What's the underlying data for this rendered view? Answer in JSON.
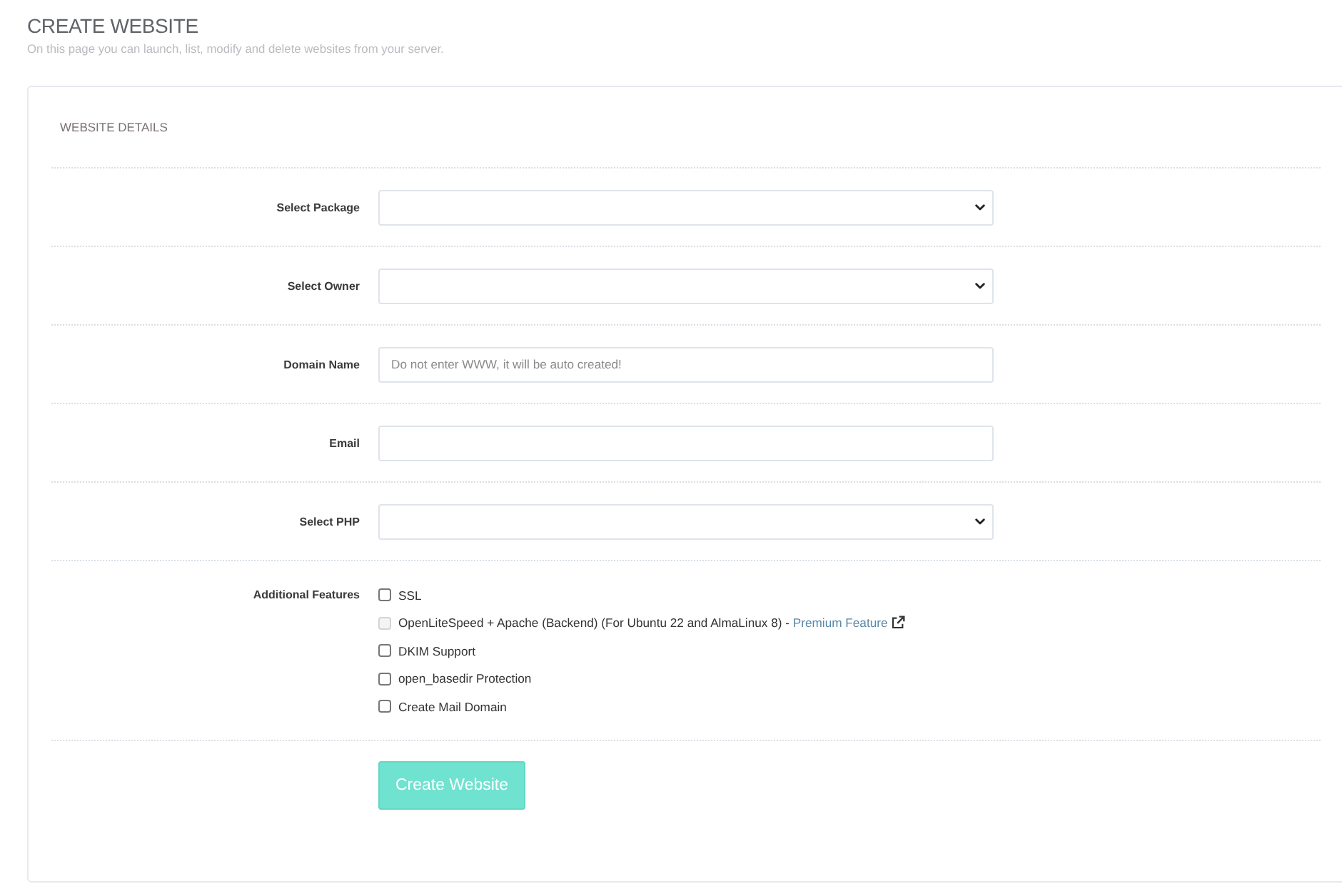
{
  "page": {
    "title": "CREATE WEBSITE",
    "subtitle": "On this page you can launch, list, modify and delete websites from your server."
  },
  "card": {
    "heading": "WEBSITE DETAILS",
    "fields": [
      {
        "label": "Select Package",
        "kind": "select"
      },
      {
        "label": "Select Owner",
        "kind": "select"
      },
      {
        "label": "Domain Name",
        "kind": "text",
        "placeholder": "Do not enter WWW, it will be auto created!"
      },
      {
        "label": "Email",
        "kind": "text"
      },
      {
        "label": "Select PHP",
        "kind": "select"
      }
    ],
    "features": {
      "label": "Additional Features",
      "options": [
        {
          "label": "SSL",
          "checked": false,
          "disabled": false
        },
        {
          "label": "OpenLiteSpeed + Apache (Backend) (For Ubuntu 22 and AlmaLinux 8) - ",
          "link": "Premium Feature",
          "checked": false,
          "disabled": true
        },
        {
          "label": "DKIM Support",
          "checked": false,
          "disabled": false
        },
        {
          "label": "open_basedir Protection",
          "checked": false,
          "disabled": false
        },
        {
          "label": "Create Mail Domain",
          "checked": false,
          "disabled": false
        }
      ]
    },
    "submit": "Create Website"
  }
}
